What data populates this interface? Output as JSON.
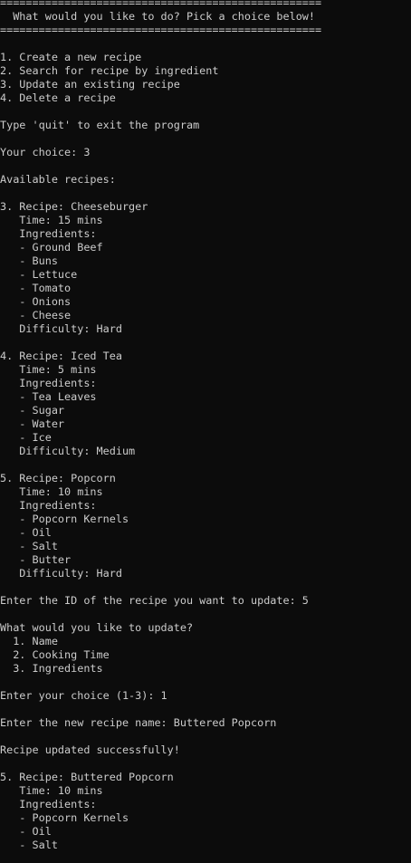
{
  "terminal": {
    "lines": [
      "==================================================",
      "  What would you like to do? Pick a choice below!",
      "==================================================",
      "",
      "1. Create a new recipe",
      "2. Search for recipe by ingredient",
      "3. Update an existing recipe",
      "4. Delete a recipe",
      "",
      "Type 'quit' to exit the program",
      "",
      "Your choice: 3",
      "",
      "Available recipes:",
      "",
      "3. Recipe: Cheeseburger",
      "   Time: 15 mins",
      "   Ingredients:",
      "   - Ground Beef",
      "   - Buns",
      "   - Lettuce",
      "   - Tomato",
      "   - Onions",
      "   - Cheese",
      "   Difficulty: Hard",
      "",
      "4. Recipe: Iced Tea",
      "   Time: 5 mins",
      "   Ingredients:",
      "   - Tea Leaves",
      "   - Sugar",
      "   - Water",
      "   - Ice",
      "   Difficulty: Medium",
      "",
      "5. Recipe: Popcorn",
      "   Time: 10 mins",
      "   Ingredients:",
      "   - Popcorn Kernels",
      "   - Oil",
      "   - Salt",
      "   - Butter",
      "   Difficulty: Hard",
      "",
      "Enter the ID of the recipe you want to update: 5",
      "",
      "What would you like to update?",
      "  1. Name",
      "  2. Cooking Time",
      "  3. Ingredients",
      "",
      "Enter your choice (1-3): 1",
      "",
      "Enter the new recipe name: Buttered Popcorn",
      "",
      "Recipe updated successfully!",
      "",
      "5. Recipe: Buttered Popcorn",
      "   Time: 10 mins",
      "   Ingredients:",
      "   - Popcorn Kernels",
      "   - Oil",
      "   - Salt"
    ]
  },
  "colors": {
    "background": "#0c0c0c",
    "text": "#cccccc"
  }
}
